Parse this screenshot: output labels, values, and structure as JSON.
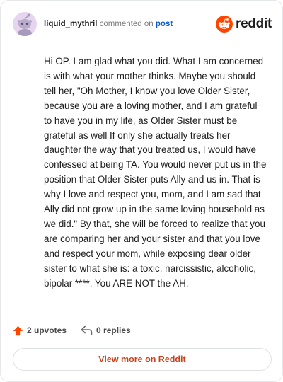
{
  "comment": {
    "author": "liquid_mythril",
    "verb": "commented on",
    "target": "post",
    "text": "Hi OP. I am glad what you did. What I am concerned is with what your mother thinks. Maybe you should tell her, \"Oh Mother, I know you love Older Sister, because you are a loving mother, and I am grateful to have you in my life, as Older Sister must be grateful as well If only she actually treats her daughter the way that you treated us, I would have confessed at being TA. You would never put us in the position that Older Sister puts Ally and us in. That is why I love and respect you, mom, and I am sad that Ally did not grow up in the same loving household as we did.\" By that, she will be forced to realize that you are comparing her and your sister and that you love and respect your mom, while exposing dear older sister to what she is: a toxic, narcissistic, alcoholic, bipolar ****. You ARE NOT the AH."
  },
  "brand": {
    "name": "reddit",
    "icon": "reddit-logo-icon",
    "color": "#ff4500"
  },
  "actions": {
    "upvotes": "2 upvotes",
    "upvote_icon": "upvote-arrow-icon",
    "replies": "0 replies",
    "reply_icon": "reply-arrow-icon"
  },
  "footer": {
    "view_more": "View more on Reddit"
  },
  "colors": {
    "accent": "#ff4500",
    "link": "#0b5bd3",
    "button_text": "#c7421a"
  }
}
